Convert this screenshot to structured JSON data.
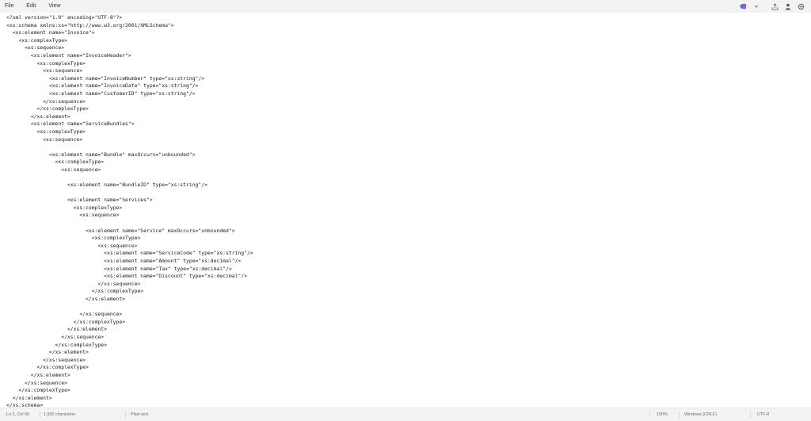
{
  "menu": {
    "file": "File",
    "edit": "Edit",
    "view": "View"
  },
  "toolbar_icons": [
    "copilot-icon",
    "chevron-down-icon",
    "share-icon",
    "account-icon",
    "settings-icon"
  ],
  "colors": {
    "copilot_blue": "#3b7be8",
    "copilot_red": "#e5533d",
    "copilot_purple": "#8b5cf6",
    "accent": "#1f1f1f"
  },
  "editor": {
    "lines": [
      "<?xml version=\"1.0\" encoding=\"UTF-8\"?>",
      "<xs:schema xmlns:xs=\"http://www.w3.org/2001/XMLSchema\">",
      "  <xs:element name=\"Invoice\">",
      "    <xs:complexType>",
      "      <xs:sequence>",
      "        <xs:element name=\"InvoiceHeader\">",
      "          <xs:complexType>",
      "            <xs:sequence>",
      "              <xs:element name=\"InvoiceNumber\" type=\"xs:string\"/>",
      "              <xs:element name=\"InvoiceDate\" type=\"xs:string\"/>",
      "              <xs:element name=\"CustomerID\" type=\"xs:string\"/>",
      "            </xs:sequence>",
      "          </xs:complexType>",
      "        </xs:element>",
      "        <xs:element name=\"ServiceBundles\">",
      "          <xs:complexType>",
      "            <xs:sequence>",
      "",
      "              <xs:element name=\"Bundle\" maxOccurs=\"unbounded\">",
      "                <xs:complexType>",
      "                  <xs:sequence>",
      "",
      "                    <xs:element name=\"BundleID\" type=\"xs:string\"/>",
      "",
      "                    <xs:element name=\"Services\">",
      "                      <xs:complexType>",
      "                        <xs:sequence>",
      "",
      "                          <xs:element name=\"Service\" maxOccurs=\"unbounded\">",
      "                            <xs:complexType>",
      "                              <xs:sequence>",
      "                                <xs:element name=\"ServiceCode\" type=\"xs:string\"/>",
      "                                <xs:element name=\"Amount\" type=\"xs:decimal\"/>",
      "                                <xs:element name=\"Tax\" type=\"xs:decimal\"/>",
      "                                <xs:element name=\"Discount\" type=\"xs:decimal\"/>",
      "                              </xs:sequence>",
      "                            </xs:complexType>",
      "                          </xs:element>",
      "",
      "                        </xs:sequence>",
      "                      </xs:complexType>",
      "                    </xs:element>",
      "                  </xs:sequence>",
      "                </xs:complexType>",
      "              </xs:element>",
      "            </xs:sequence>",
      "          </xs:complexType>",
      "        </xs:element>",
      "      </xs:sequence>",
      "    </xs:complexType>",
      "  </xs:element>",
      "</xs:schema>"
    ]
  },
  "status": {
    "position": "Ln 2, Col 56",
    "characters": "1,920 characters",
    "format": "Plain text",
    "zoom": "100%",
    "line_ending": "Windows (CRLF)",
    "encoding": "UTF-8"
  }
}
